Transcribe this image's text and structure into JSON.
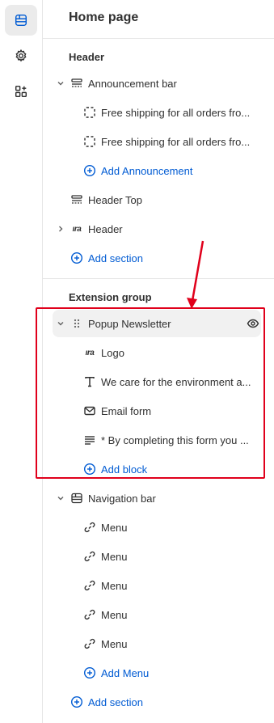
{
  "page": {
    "title": "Home page"
  },
  "rail": {
    "items": [
      {
        "icon": "sections-icon",
        "active": true
      },
      {
        "icon": "gear-icon",
        "active": false
      },
      {
        "icon": "apps-add-icon",
        "active": false
      }
    ]
  },
  "groups": {
    "header": {
      "label": "Header",
      "announcement_bar": "Announcement bar",
      "announcements": [
        "Free shipping for all orders fro...",
        "Free shipping for all orders fro..."
      ],
      "add_announcement": "Add Announcement",
      "header_top": "Header Top",
      "header": "Header",
      "add_section": "Add section"
    },
    "extension": {
      "label": "Extension group",
      "popup_newsletter": "Popup Newsletter",
      "blocks": [
        {
          "icon": "logo-icon",
          "label": "Logo"
        },
        {
          "icon": "text-icon",
          "label": "We care for the environment a..."
        },
        {
          "icon": "email-icon",
          "label": "Email form"
        },
        {
          "icon": "paragraph-icon",
          "label": "* By completing this form you ..."
        }
      ],
      "add_block": "Add block",
      "navigation_bar": "Navigation bar",
      "menus": [
        "Menu",
        "Menu",
        "Menu",
        "Menu",
        "Menu"
      ],
      "add_menu": "Add Menu",
      "add_section": "Add section"
    }
  },
  "logo_glyph": "ıra",
  "colors": {
    "accent": "#005bd3",
    "annotation": "#e0001b",
    "selected_bg": "#f1f1f1"
  }
}
